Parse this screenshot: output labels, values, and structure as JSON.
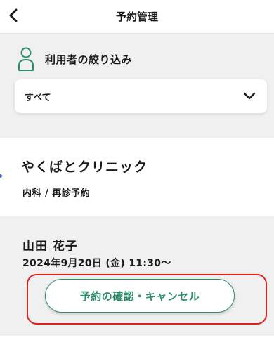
{
  "header": {
    "title": "予約管理",
    "back_icon": "chevron-left-icon"
  },
  "filter": {
    "label": "利用者の絞り込み",
    "icon": "person-icon",
    "selected_value": "すべて",
    "dropdown_icon": "chevron-down-icon"
  },
  "clinic": {
    "name": "やくばとクリニック",
    "detail": "内科 / 再診予約"
  },
  "booking": {
    "patient_name": "山田 花子",
    "datetime": "2024年9月20日 (金)  11:30～",
    "action_label": "予約の確認・キャンセル"
  },
  "colors": {
    "accent": "#2e8c6b",
    "highlight": "#e0201a",
    "background": "#f0f0f0",
    "card": "#ffffff"
  }
}
